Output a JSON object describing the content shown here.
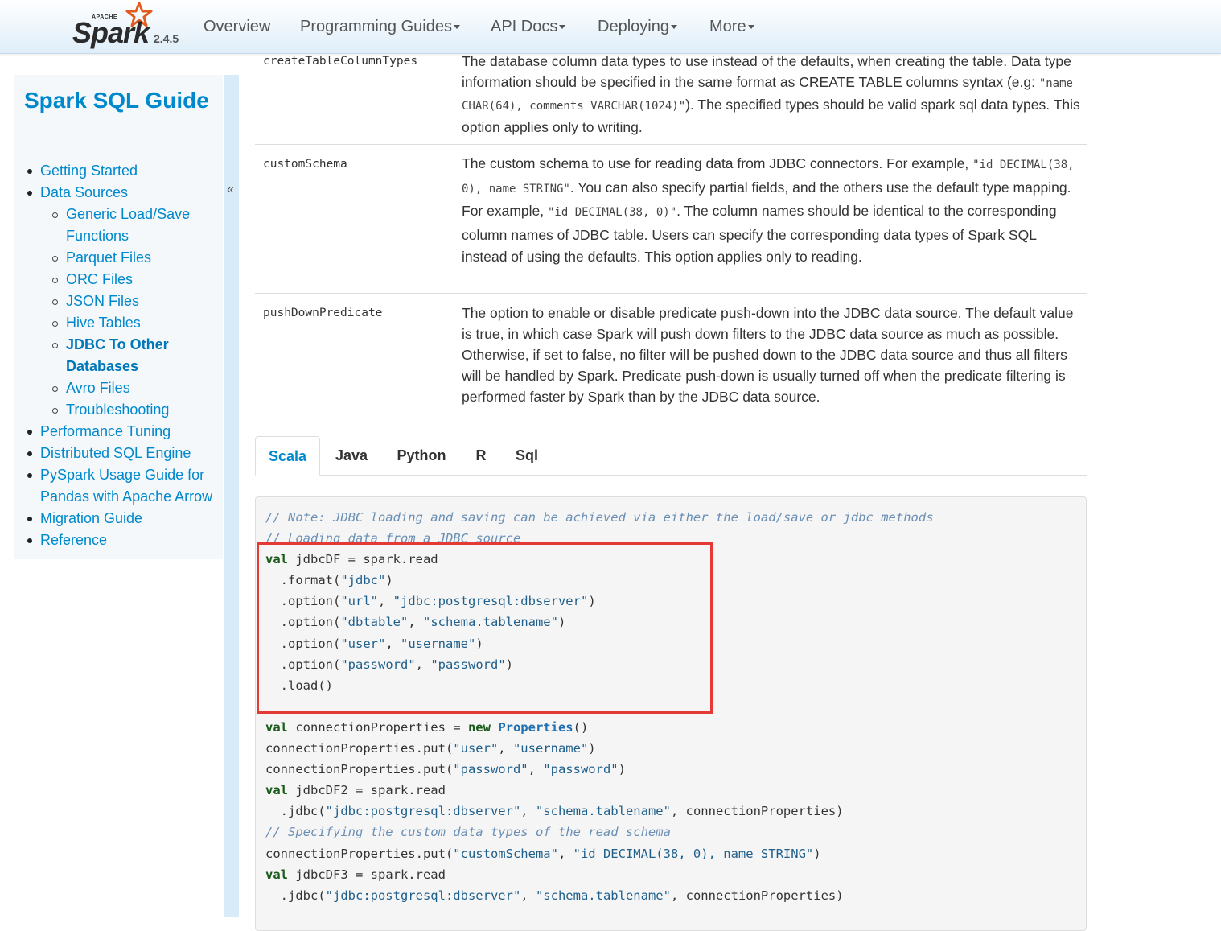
{
  "navbar": {
    "logo_apache": "APACHE",
    "logo_spark": "Spark",
    "version": "2.4.5",
    "items": [
      {
        "label": "Overview",
        "dropdown": false
      },
      {
        "label": "Programming Guides",
        "dropdown": true
      },
      {
        "label": "API Docs",
        "dropdown": true
      },
      {
        "label": "Deploying",
        "dropdown": true
      },
      {
        "label": "More",
        "dropdown": true
      }
    ]
  },
  "sidebar": {
    "title": "Spark SQL Guide",
    "collapse_glyph": "«",
    "items": [
      {
        "label": "Getting Started",
        "level": 1
      },
      {
        "label": "Data Sources",
        "level": 1
      },
      {
        "label": "Generic Load/Save Functions",
        "level": 2
      },
      {
        "label": "Parquet Files",
        "level": 2
      },
      {
        "label": "ORC Files",
        "level": 2
      },
      {
        "label": "JSON Files",
        "level": 2
      },
      {
        "label": "Hive Tables",
        "level": 2
      },
      {
        "label": "JDBC To Other Databases",
        "level": 2,
        "active": true
      },
      {
        "label": "Avro Files",
        "level": 2
      },
      {
        "label": "Troubleshooting",
        "level": 2
      },
      {
        "label": "Performance Tuning",
        "level": 1
      },
      {
        "label": "Distributed SQL Engine",
        "level": 1
      },
      {
        "label": "PySpark Usage Guide for Pandas with Apache Arrow",
        "level": 1
      },
      {
        "label": "Migration Guide",
        "level": 1
      },
      {
        "label": "Reference",
        "level": 1
      }
    ]
  },
  "options": {
    "rows": [
      {
        "name": "createTableColumnTypes",
        "desc_1": "The database column data types to use instead of the defaults, when creating the table. Data type information should be specified in the same format as CREATE TABLE columns syntax (e.g: ",
        "code_1": "\"name CHAR(64), comments VARCHAR(1024)\"",
        "desc_2": "). The specified types should be valid spark sql data types. This option applies only to writing."
      },
      {
        "name": "customSchema",
        "desc_1": "The custom schema to use for reading data from JDBC connectors. For example, ",
        "code_1": "\"id DECIMAL(38, 0), name STRING\"",
        "desc_2": ". You can also specify partial fields, and the others use the default type mapping. For example, ",
        "code_2": "\"id DECIMAL(38, 0)\"",
        "desc_3": ". The column names should be identical to the corresponding column names of JDBC table. Users can specify the corresponding data types of Spark SQL instead of using the defaults. This option applies only to reading."
      },
      {
        "name": "pushDownPredicate",
        "desc_1": "The option to enable or disable predicate push-down into the JDBC data source. The default value is true, in which case Spark will push down filters to the JDBC data source as much as possible. Otherwise, if set to false, no filter will be pushed down to the JDBC data source and thus all filters will be handled by Spark. Predicate push-down is usually turned off when the predicate filtering is performed faster by Spark than by the JDBC data source."
      }
    ]
  },
  "tabs": {
    "items": [
      "Scala",
      "Java",
      "Python",
      "R",
      "Sql"
    ],
    "active": "Scala"
  },
  "code": {
    "lines": [
      "// Note: JDBC loading and saving can be achieved via either the load/save or jdbc methods",
      "// Loading data from a JDBC source",
      "val jdbcDF = spark.read",
      "  .format(\"jdbc\")",
      "  .option(\"url\", \"jdbc:postgresql:dbserver\")",
      "  .option(\"dbtable\", \"schema.tablename\")",
      "  .option(\"user\", \"username\")",
      "  .option(\"password\", \"password\")",
      "  .load()",
      "",
      "val connectionProperties = new Properties()",
      "connectionProperties.put(\"user\", \"username\")",
      "connectionProperties.put(\"password\", \"password\")",
      "val jdbcDF2 = spark.read",
      "  .jdbc(\"jdbc:postgresql:dbserver\", \"schema.tablename\", connectionProperties)",
      "// Specifying the custom data types of the read schema",
      "connectionProperties.put(\"customSchema\", \"id DECIMAL(38, 0), name STRING\")",
      "val jdbcDF3 = spark.read",
      "  .jdbc(\"jdbc:postgresql:dbserver\", \"schema.tablename\", connectionProperties)"
    ]
  },
  "colors": {
    "link": "#0088cc",
    "highlight": "#e53935",
    "keyword": "#1a5a1a",
    "string": "#1f5f8b",
    "comment": "#6a8fb5"
  }
}
